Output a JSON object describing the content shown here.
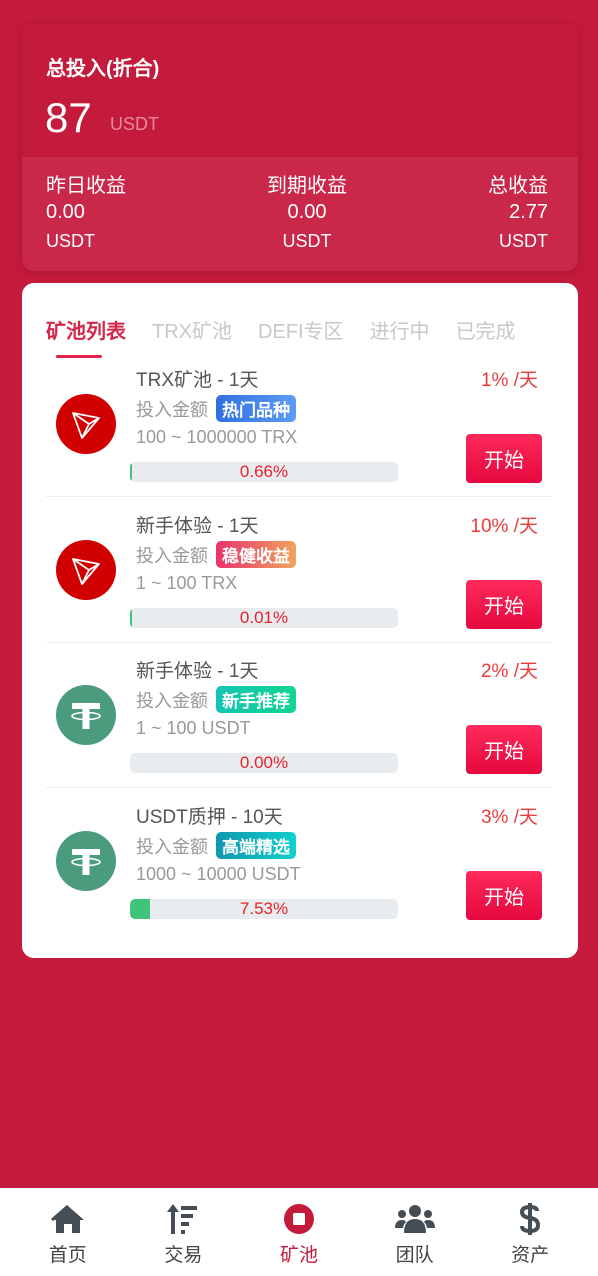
{
  "summary": {
    "title": "总投入(折合)",
    "amount": "87",
    "unit": "USDT",
    "stats": [
      {
        "label": "昨日收益",
        "value": "0.00",
        "unit": "USDT"
      },
      {
        "label": "到期收益",
        "value": "0.00",
        "unit": "USDT"
      },
      {
        "label": "总收益",
        "value": "2.77",
        "unit": "USDT"
      }
    ]
  },
  "tabs": [
    {
      "label": "矿池列表",
      "active": true
    },
    {
      "label": "TRX矿池",
      "active": false
    },
    {
      "label": "DEFI专区",
      "active": false
    },
    {
      "label": "进行中",
      "active": false
    },
    {
      "label": "已完成",
      "active": false
    }
  ],
  "pools": [
    {
      "name": "TRX矿池 - 1天",
      "coin": "trx",
      "invest_label": "投入金额",
      "badge": "热门品种",
      "badge_colors": [
        "#2f6fe0",
        "#5e9cf5"
      ],
      "range": "100 ~ 1000000 TRX",
      "progress_percent": 0.66,
      "progress_text": "0.66%",
      "rate": "1% /天",
      "button": "开始"
    },
    {
      "name": "新手体验 - 1天",
      "coin": "trx",
      "invest_label": "投入金额",
      "badge": "稳健收益",
      "badge_colors": [
        "#e8336b",
        "#f0a45e"
      ],
      "range": "1 ~ 100 TRX",
      "progress_percent": 0.01,
      "progress_text": "0.01%",
      "rate": "10% /天",
      "button": "开始"
    },
    {
      "name": "新手体验 - 1天",
      "coin": "usdt",
      "invest_label": "投入金额",
      "badge": "新手推荐",
      "badge_colors": [
        "#14c5b4",
        "#12d68e"
      ],
      "range": "1 ~ 100 USDT",
      "progress_percent": 0.0,
      "progress_text": "0.00%",
      "rate": "2% /天",
      "button": "开始"
    },
    {
      "name": "USDT质押 - 10天",
      "coin": "usdt",
      "invest_label": "投入金额",
      "badge": "高端精选",
      "badge_colors": [
        "#1296b0",
        "#10d0cc"
      ],
      "range": "1000 ~ 10000 USDT",
      "progress_percent": 7.53,
      "progress_text": "7.53%",
      "rate": "3% /天",
      "button": "开始"
    }
  ],
  "nav": [
    {
      "label": "首页",
      "icon": "home-icon",
      "active": false
    },
    {
      "label": "交易",
      "icon": "sort-icon",
      "active": false
    },
    {
      "label": "矿池",
      "icon": "stop-circle-icon",
      "active": true
    },
    {
      "label": "团队",
      "icon": "users-icon",
      "active": false
    },
    {
      "label": "资产",
      "icon": "dollar-icon",
      "active": false
    }
  ],
  "colors": {
    "brand": "#c41a3c",
    "accent": "#e8204e",
    "progress": "#3fc47c"
  }
}
